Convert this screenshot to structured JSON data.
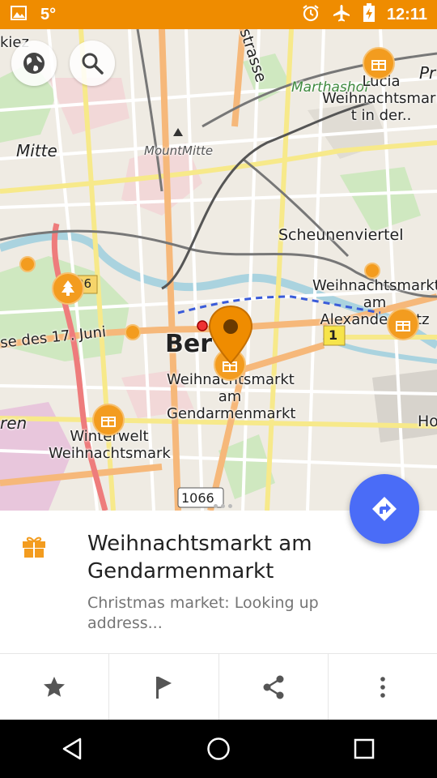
{
  "status_bar": {
    "temperature": "5°",
    "time": "12:11",
    "background_color": "#ef8c00",
    "icons": [
      "gallery-icon",
      "alarm-icon",
      "airplane-mode-icon",
      "battery-charging-icon"
    ]
  },
  "map": {
    "controls": [
      "globe-icon",
      "search-icon"
    ],
    "labels": {
      "kiez": "kiez",
      "strasse": "strasse",
      "marthashof": "Marthashof",
      "pr": "Pr",
      "mitte": "Mitte",
      "mount_mitte": "MountMitte",
      "scheunenviertel": "Scheunenviertel",
      "lucia_1": "Lucia",
      "lucia_2": "Weihnachtsmark",
      "lucia_3": "t in der..",
      "alex_1": "Weihnachtsmarkt",
      "alex_2": "am",
      "alex_3": "Alexanderplatz",
      "juni": "se des 17. Juni",
      "ber": "Ber",
      "gend_1": "Weihnachtsmarkt",
      "gend_2": "am",
      "gend_3": "Gendarmenmarkt",
      "ren": "ren",
      "winterwelt_1": "Winterwelt",
      "winterwelt_2": "Weihnachtsmark",
      "ho": "Ho",
      "road_96": "96",
      "road_1": "1",
      "road_1066": "1066"
    }
  },
  "route_button": {
    "icon": "directions-icon",
    "color": "#4a6cf7"
  },
  "place": {
    "icon": "gift-icon",
    "title": "Weihnachtsmarkt am Gendarmenmarkt",
    "subtitle": "Christmas market: Looking up address..."
  },
  "actions": [
    {
      "icon": "star-icon"
    },
    {
      "icon": "flag-icon"
    },
    {
      "icon": "share-icon"
    },
    {
      "icon": "more-vert-icon"
    }
  ],
  "nav_bar": [
    "back-icon",
    "home-icon",
    "recents-icon"
  ],
  "colors": {
    "accent": "#f39c1f",
    "marker": "#ef8c00"
  }
}
